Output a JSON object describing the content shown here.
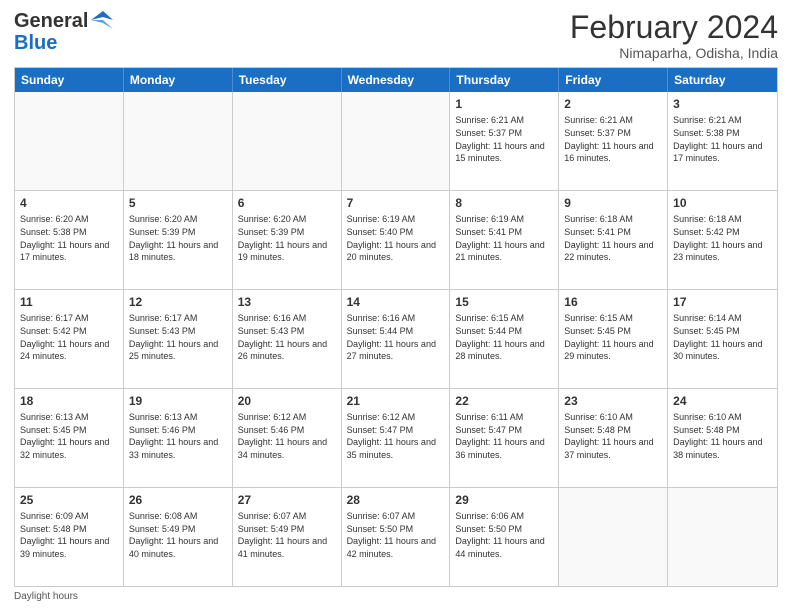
{
  "header": {
    "logo_line1": "General",
    "logo_line2": "Blue",
    "title": "February 2024",
    "subtitle": "Nimaparha, Odisha, India"
  },
  "day_headers": [
    "Sunday",
    "Monday",
    "Tuesday",
    "Wednesday",
    "Thursday",
    "Friday",
    "Saturday"
  ],
  "weeks": [
    [
      {
        "day": "",
        "info": ""
      },
      {
        "day": "",
        "info": ""
      },
      {
        "day": "",
        "info": ""
      },
      {
        "day": "",
        "info": ""
      },
      {
        "day": "1",
        "info": "Sunrise: 6:21 AM\nSunset: 5:37 PM\nDaylight: 11 hours and 15 minutes."
      },
      {
        "day": "2",
        "info": "Sunrise: 6:21 AM\nSunset: 5:37 PM\nDaylight: 11 hours and 16 minutes."
      },
      {
        "day": "3",
        "info": "Sunrise: 6:21 AM\nSunset: 5:38 PM\nDaylight: 11 hours and 17 minutes."
      }
    ],
    [
      {
        "day": "4",
        "info": "Sunrise: 6:20 AM\nSunset: 5:38 PM\nDaylight: 11 hours and 17 minutes."
      },
      {
        "day": "5",
        "info": "Sunrise: 6:20 AM\nSunset: 5:39 PM\nDaylight: 11 hours and 18 minutes."
      },
      {
        "day": "6",
        "info": "Sunrise: 6:20 AM\nSunset: 5:39 PM\nDaylight: 11 hours and 19 minutes."
      },
      {
        "day": "7",
        "info": "Sunrise: 6:19 AM\nSunset: 5:40 PM\nDaylight: 11 hours and 20 minutes."
      },
      {
        "day": "8",
        "info": "Sunrise: 6:19 AM\nSunset: 5:41 PM\nDaylight: 11 hours and 21 minutes."
      },
      {
        "day": "9",
        "info": "Sunrise: 6:18 AM\nSunset: 5:41 PM\nDaylight: 11 hours and 22 minutes."
      },
      {
        "day": "10",
        "info": "Sunrise: 6:18 AM\nSunset: 5:42 PM\nDaylight: 11 hours and 23 minutes."
      }
    ],
    [
      {
        "day": "11",
        "info": "Sunrise: 6:17 AM\nSunset: 5:42 PM\nDaylight: 11 hours and 24 minutes."
      },
      {
        "day": "12",
        "info": "Sunrise: 6:17 AM\nSunset: 5:43 PM\nDaylight: 11 hours and 25 minutes."
      },
      {
        "day": "13",
        "info": "Sunrise: 6:16 AM\nSunset: 5:43 PM\nDaylight: 11 hours and 26 minutes."
      },
      {
        "day": "14",
        "info": "Sunrise: 6:16 AM\nSunset: 5:44 PM\nDaylight: 11 hours and 27 minutes."
      },
      {
        "day": "15",
        "info": "Sunrise: 6:15 AM\nSunset: 5:44 PM\nDaylight: 11 hours and 28 minutes."
      },
      {
        "day": "16",
        "info": "Sunrise: 6:15 AM\nSunset: 5:45 PM\nDaylight: 11 hours and 29 minutes."
      },
      {
        "day": "17",
        "info": "Sunrise: 6:14 AM\nSunset: 5:45 PM\nDaylight: 11 hours and 30 minutes."
      }
    ],
    [
      {
        "day": "18",
        "info": "Sunrise: 6:13 AM\nSunset: 5:45 PM\nDaylight: 11 hours and 32 minutes."
      },
      {
        "day": "19",
        "info": "Sunrise: 6:13 AM\nSunset: 5:46 PM\nDaylight: 11 hours and 33 minutes."
      },
      {
        "day": "20",
        "info": "Sunrise: 6:12 AM\nSunset: 5:46 PM\nDaylight: 11 hours and 34 minutes."
      },
      {
        "day": "21",
        "info": "Sunrise: 6:12 AM\nSunset: 5:47 PM\nDaylight: 11 hours and 35 minutes."
      },
      {
        "day": "22",
        "info": "Sunrise: 6:11 AM\nSunset: 5:47 PM\nDaylight: 11 hours and 36 minutes."
      },
      {
        "day": "23",
        "info": "Sunrise: 6:10 AM\nSunset: 5:48 PM\nDaylight: 11 hours and 37 minutes."
      },
      {
        "day": "24",
        "info": "Sunrise: 6:10 AM\nSunset: 5:48 PM\nDaylight: 11 hours and 38 minutes."
      }
    ],
    [
      {
        "day": "25",
        "info": "Sunrise: 6:09 AM\nSunset: 5:48 PM\nDaylight: 11 hours and 39 minutes."
      },
      {
        "day": "26",
        "info": "Sunrise: 6:08 AM\nSunset: 5:49 PM\nDaylight: 11 hours and 40 minutes."
      },
      {
        "day": "27",
        "info": "Sunrise: 6:07 AM\nSunset: 5:49 PM\nDaylight: 11 hours and 41 minutes."
      },
      {
        "day": "28",
        "info": "Sunrise: 6:07 AM\nSunset: 5:50 PM\nDaylight: 11 hours and 42 minutes."
      },
      {
        "day": "29",
        "info": "Sunrise: 6:06 AM\nSunset: 5:50 PM\nDaylight: 11 hours and 44 minutes."
      },
      {
        "day": "",
        "info": ""
      },
      {
        "day": "",
        "info": ""
      }
    ]
  ],
  "footer": {
    "daylight_label": "Daylight hours"
  }
}
